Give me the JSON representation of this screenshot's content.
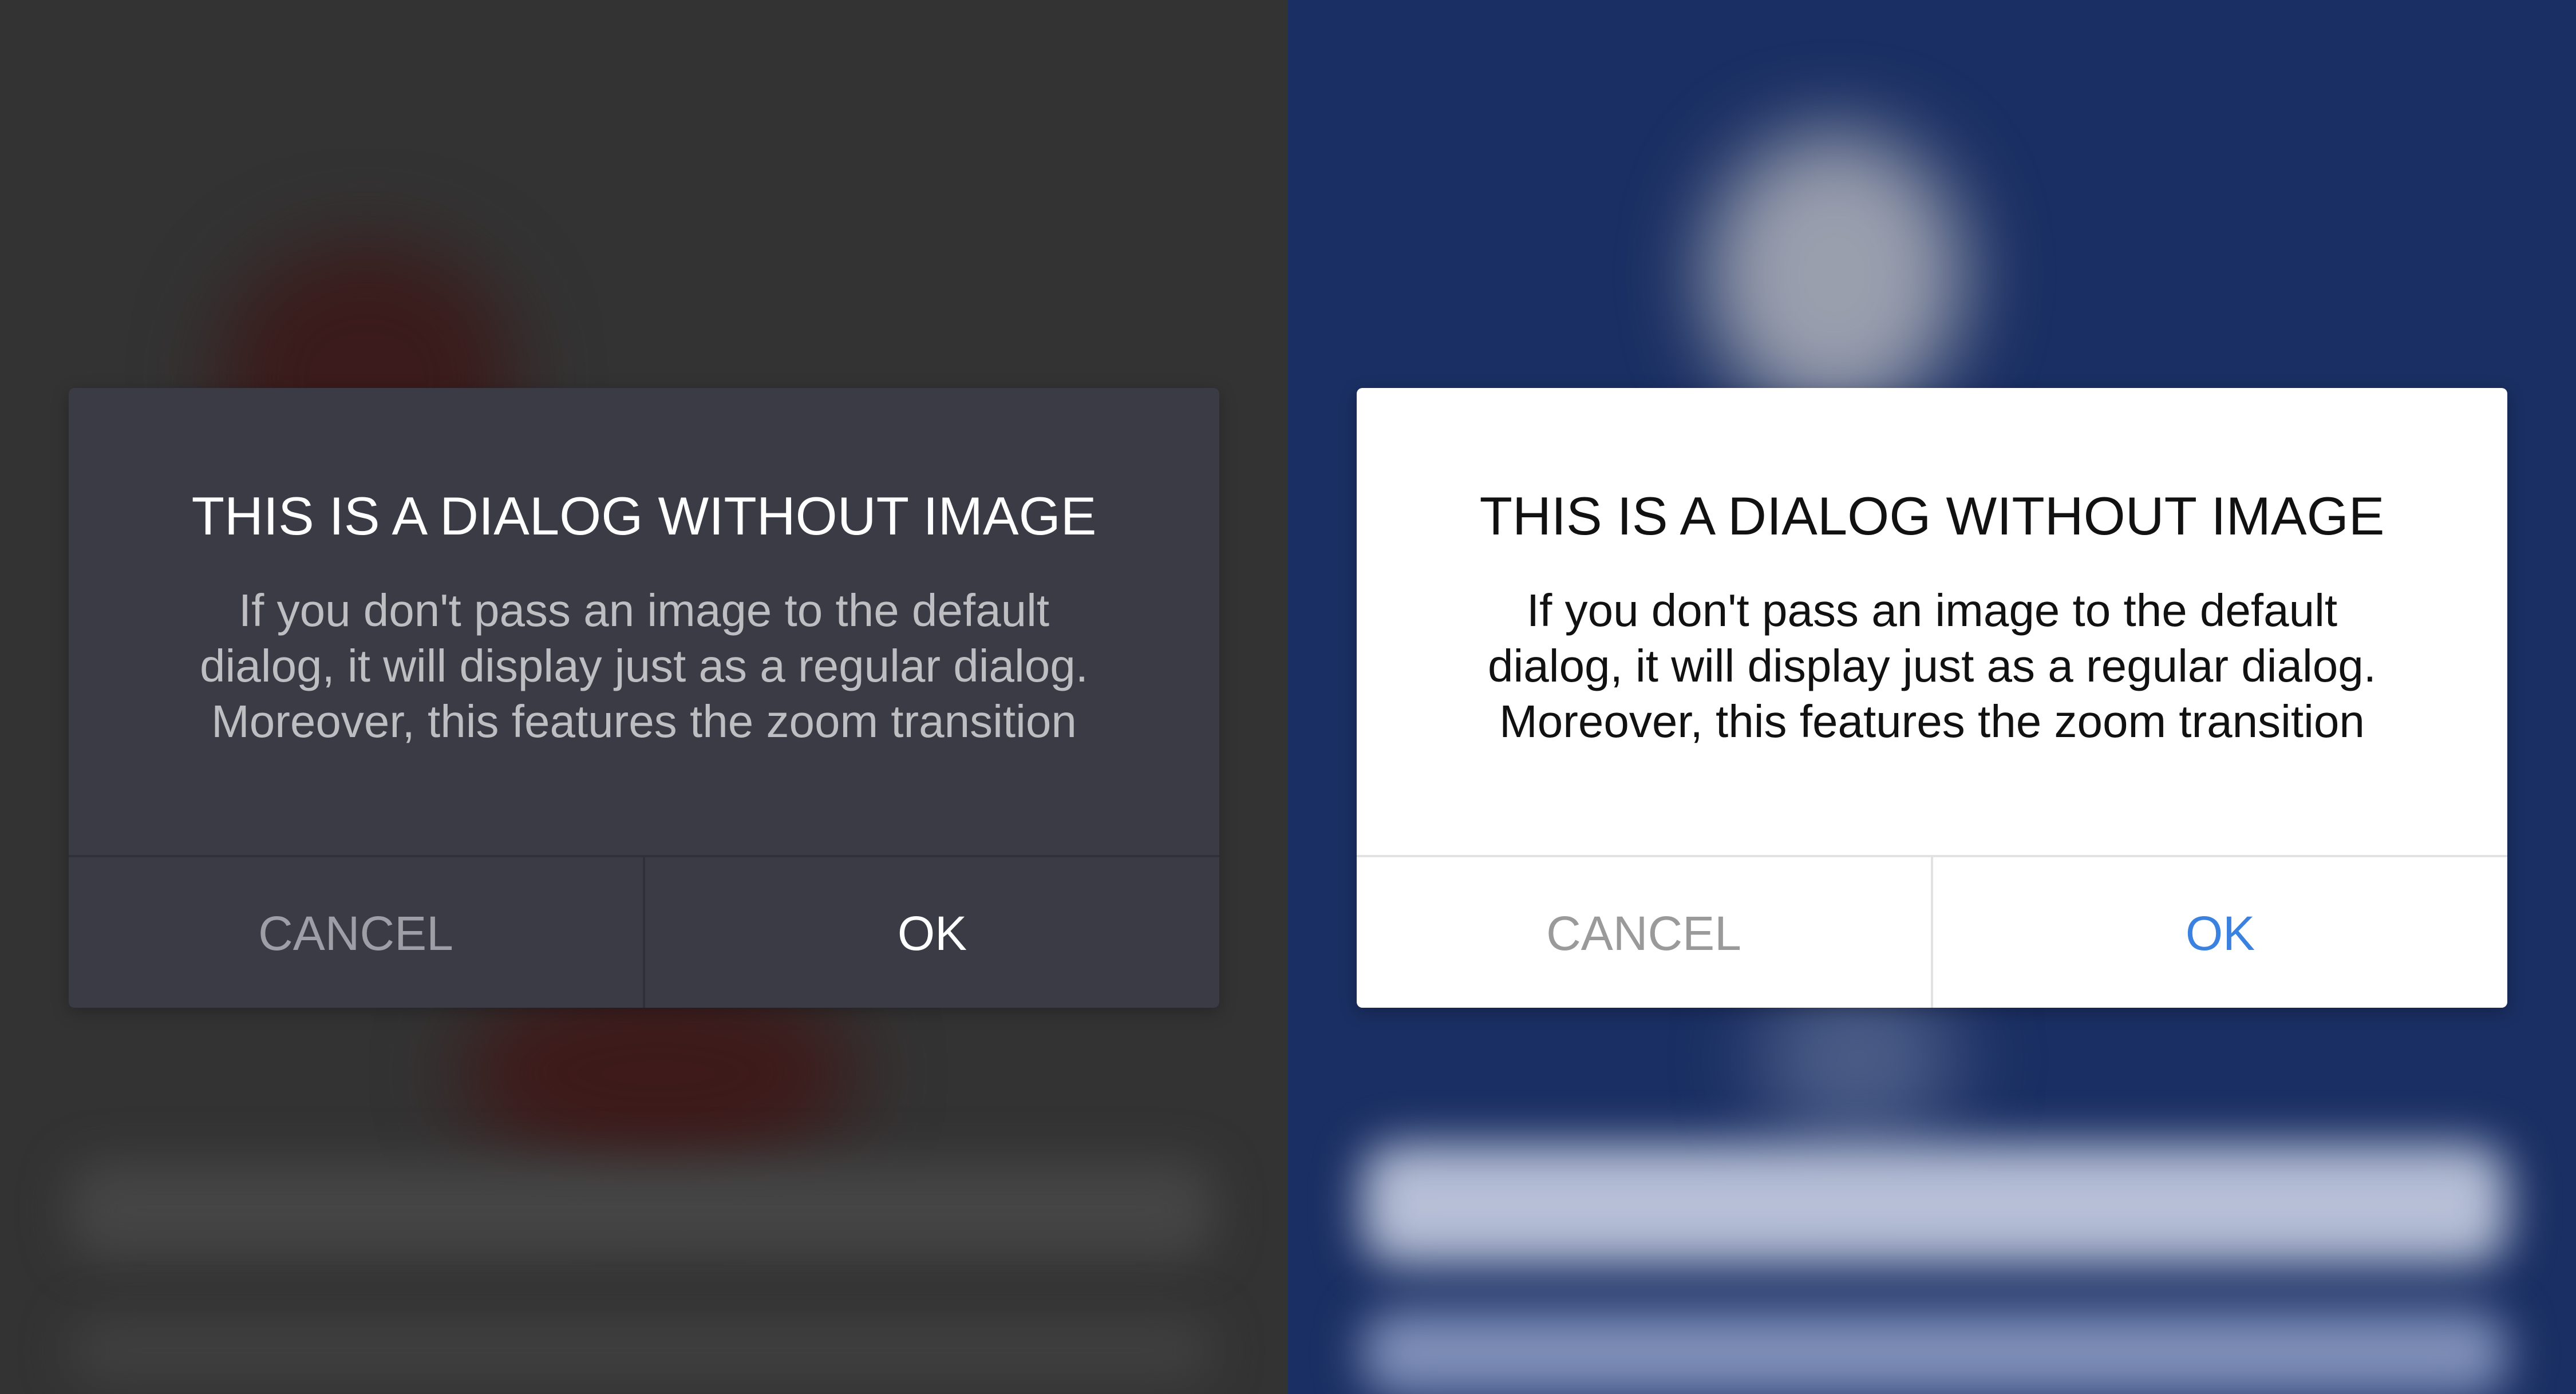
{
  "dark_dialog": {
    "title": "THIS IS A DIALOG WITHOUT IMAGE",
    "body": "If you don't pass an image to the default\ndialog, it will display just as a regular dialog.\nMoreover, this features the zoom transition",
    "cancel_label": "CANCEL",
    "ok_label": "OK"
  },
  "light_dialog": {
    "title": "THIS IS A DIALOG WITHOUT IMAGE",
    "body": "If you don't pass an image to the default\ndialog, it will display just as a regular dialog.\nMoreover, this features the zoom transition",
    "cancel_label": "CANCEL",
    "ok_label": "OK"
  },
  "colors": {
    "dark_background": "#333333",
    "dark_dialog": "#3a3b45",
    "light_background": "#1a2f63",
    "light_dialog": "#ffffff",
    "ok_accent_light": "#3b82e0"
  }
}
